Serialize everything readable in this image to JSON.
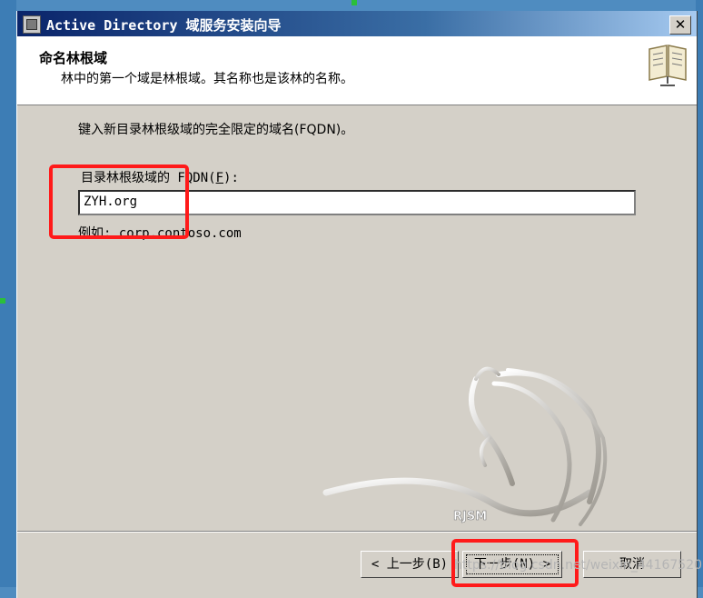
{
  "window": {
    "title": "Active Directory 域服务安装向导",
    "close_glyph": "✕"
  },
  "header": {
    "title": "命名林根域",
    "subtitle": "林中的第一个域是林根域。其名称也是该林的名称。"
  },
  "body": {
    "instruction": "键入新目录林根级域的完全限定的域名(FQDN)。",
    "fqdn_label_prefix": "目录林根级域的 FQDN(",
    "fqdn_label_accel": "F",
    "fqdn_label_suffix": "):",
    "fqdn_value": "ZYH.org",
    "example": "例如: corp.contoso.com"
  },
  "logo": {
    "text": "RJSM"
  },
  "buttons": {
    "back": "< 上一步(B)",
    "next": "下一步(N) >",
    "cancel": "取消"
  },
  "watermark": "https://blog.csdn.net/weixin_44167520",
  "colors": {
    "titlebar_start": "#0a246a",
    "highlight": "#ff1a1a",
    "dialog_bg": "#d4d0c8"
  }
}
